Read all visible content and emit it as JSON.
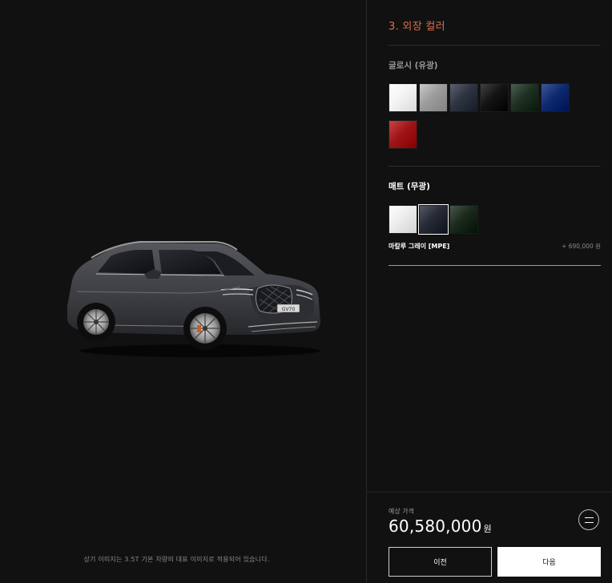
{
  "step": {
    "title": "3. 외장 컬러"
  },
  "glossy": {
    "label": "글로시 (유광)",
    "swatches": [
      {
        "icon": "white-swatch",
        "color": "#f3f3f3"
      },
      {
        "icon": "silver-swatch",
        "color": "#9c9c9c"
      },
      {
        "icon": "slate-grey-swatch",
        "color": "#2e3440"
      },
      {
        "icon": "black-swatch",
        "color": "#141414"
      },
      {
        "icon": "dark-green-swatch",
        "color": "#1f3122"
      },
      {
        "icon": "navy-blue-swatch",
        "color": "#0f2a6e"
      },
      {
        "icon": "red-swatch",
        "color": "#9f1518"
      }
    ]
  },
  "matte": {
    "label": "매트 (무광)",
    "swatches": [
      {
        "icon": "matte-white-swatch",
        "color": "#ececec"
      },
      {
        "icon": "matte-grey-swatch",
        "color": "#262b35",
        "selected": true
      },
      {
        "icon": "matte-green-swatch",
        "color": "#1b2a1d"
      }
    ],
    "selected_name": "마칼루 그레이 [MPE]",
    "selected_price": "+ 690,000 원"
  },
  "price": {
    "label": "예상 가격",
    "value": "60,580,000",
    "unit": "원"
  },
  "buttons": {
    "prev": "이전",
    "next": "다음"
  },
  "car": {
    "badge": "GV70",
    "body_color": "#3d3e43",
    "icon": "car-exterior-image"
  },
  "disclaimer": "상기 이미지는 3.5T 기본 차량의 대표 이미지로 적용되어 있습니다."
}
